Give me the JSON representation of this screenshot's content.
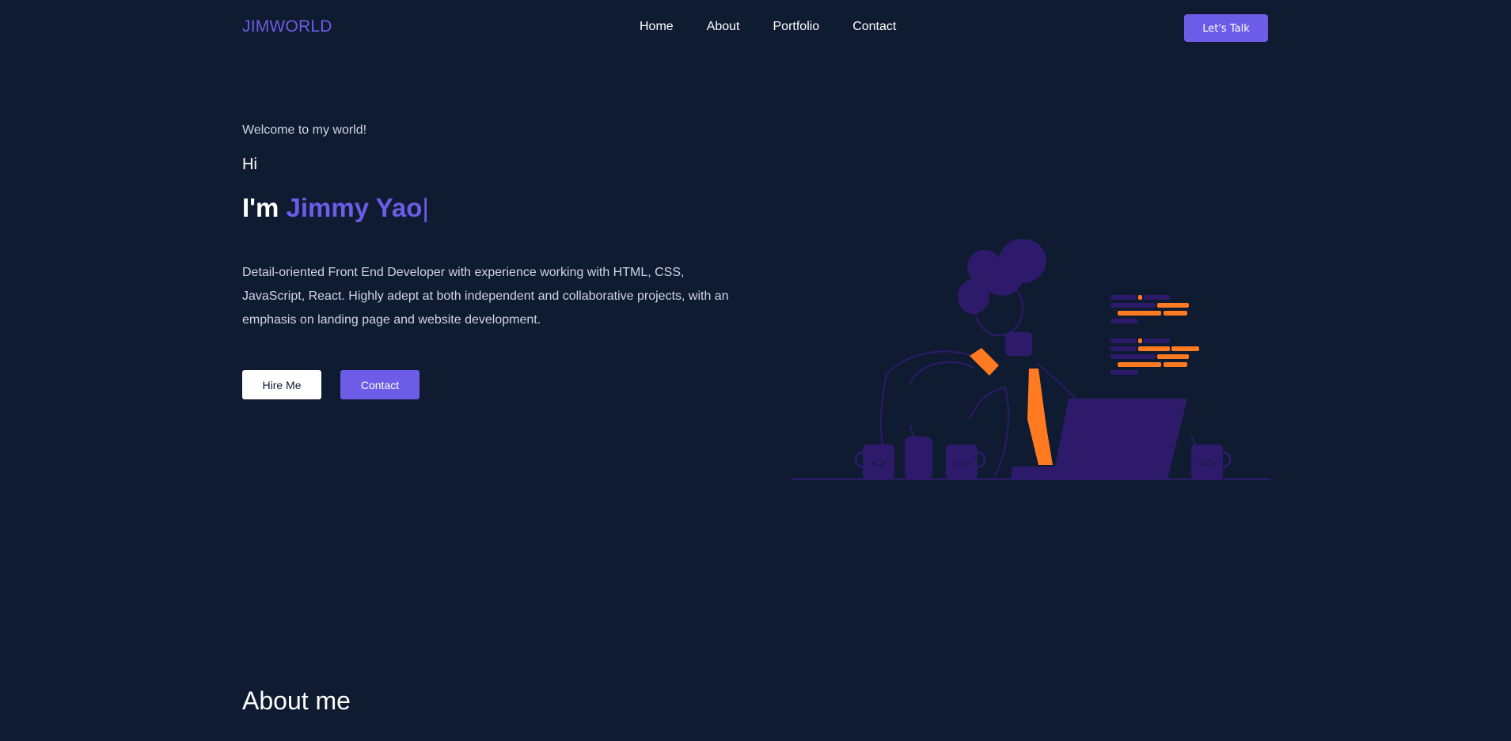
{
  "nav": {
    "brand": "JIMWORLD",
    "links": [
      "Home",
      "About",
      "Portfolio",
      "Contact"
    ],
    "cta_label": "Let's Talk"
  },
  "hero": {
    "welcome": "Welcome to my world!",
    "hi": "Hi",
    "im": "I'm",
    "name": "Jimmy Yao",
    "cursor": "|",
    "bio": "Detail-oriented Front End Developer with experience working with HTML, CSS, JavaScript, React. Highly adept at both independent and collaborative projects, with an emphasis on landing page and website development.",
    "hire_label": "Hire Me",
    "contact_label": "Contact"
  },
  "about": {
    "title": "About me"
  },
  "colors": {
    "background": "#0f1b31",
    "accent": "#6c5ce7",
    "illustration_purple": "#2e1a6b",
    "illustration_orange": "#ff7a21"
  }
}
